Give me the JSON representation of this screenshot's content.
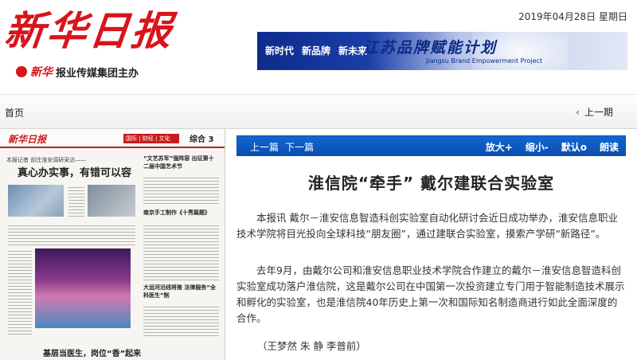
{
  "header": {
    "logo_text": "新华日报",
    "sub_mark": "新华",
    "sub_text": "报业传媒集团主办",
    "date_text": "2019年04月28日 星期日",
    "banner": {
      "left_items": [
        "新时代",
        "新品牌",
        "新未来"
      ],
      "calligraphy": "江苏品牌赋能计划",
      "english": "Jiangsu Brand Empowerment Project"
    }
  },
  "nav": {
    "home": "首页",
    "prev_issue": "上一期"
  },
  "paper": {
    "page_logo": "新华日报",
    "page_tag": "国际 | 财经 | 文化",
    "page_number": "综合 3",
    "kicker": "本报记者 前往淮安调研采访——",
    "headline": "真心办实事，有错可以容",
    "title_a": "“文艺苏军”强阵容 出征第十二届中国艺术节",
    "title_b": "南京手工制作《十秀篇题》",
    "title_c": "大运河沿线将推 法律服务“全科医生”制",
    "bottom_headline": "基层当医生，岗位“香”起来"
  },
  "article": {
    "prev_article": "上一篇",
    "next_article": "下一篇",
    "zoom_in": "放大+",
    "zoom_out": "缩小-",
    "default": "默认o",
    "read_aloud": "朗读",
    "title": "淮信院“牵手” 戴尔建联合实验室",
    "para1": "本报讯 戴尔－淮安信息智造科创实验室自动化研讨会近日成功举办，淮安信息职业技术学院将目光投向全球科技“朋友圈”，通过建联合实验室，摸索产学研“新路径”。",
    "para2": "去年9月，由戴尔公司和淮安信息职业技术学院合作建立的戴尔－淮安信息智造科创实验室成功落户淮信院，这是戴尔公司在中国第一次投资建立专门用于智能制造技术展示和孵化的实验室，也是淮信院40年历史上第一次和国际知名制造商进行如此全面深度的合作。",
    "byline": "（王梦然 朱 静 李普前）"
  }
}
